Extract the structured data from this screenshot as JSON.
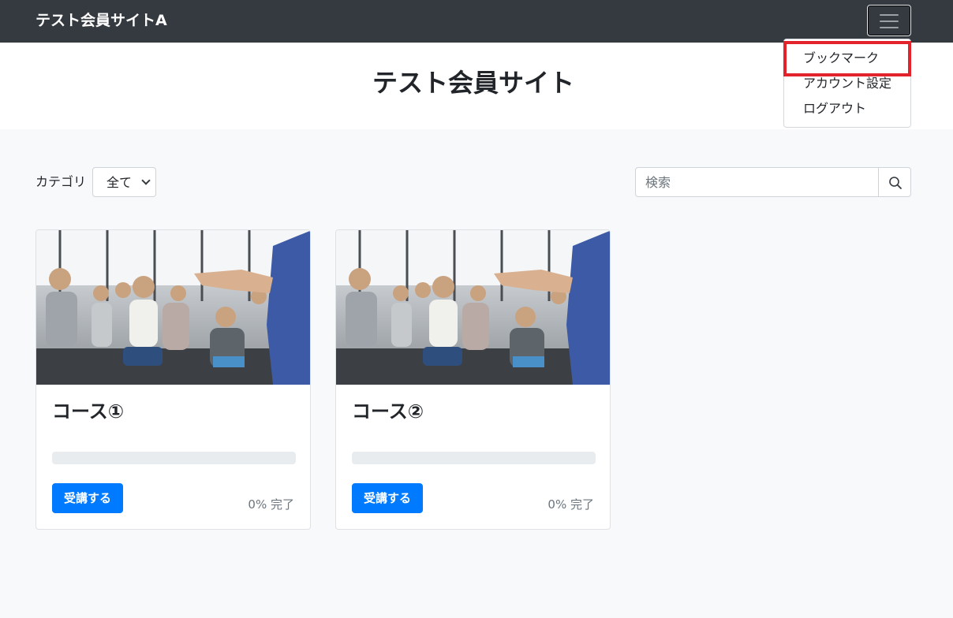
{
  "navbar": {
    "brand": "テスト会員サイトA",
    "toggler_icon": "hamburger-menu-icon"
  },
  "hero": {
    "title": "テスト会員サイト"
  },
  "dropdown_menu": {
    "items": [
      {
        "label": "ブックマーク",
        "highlighted": true
      },
      {
        "label": "アカウント設定"
      },
      {
        "label": "ログアウト"
      }
    ]
  },
  "filter": {
    "category_label": "カテゴリ",
    "category_value": "全て"
  },
  "search": {
    "placeholder": "検索",
    "icon": "search-icon"
  },
  "courses": [
    {
      "title": "コース①",
      "progress": 0,
      "button_label": "受講する",
      "completion_text": "0% 完了"
    },
    {
      "title": "コース②",
      "progress": 0,
      "button_label": "受講する",
      "completion_text": "0% 完了"
    }
  ],
  "colors": {
    "navbar": "#343a40",
    "primary": "#007bff",
    "highlight_border": "#e3232c",
    "page_bg": "#f8f9fa"
  }
}
